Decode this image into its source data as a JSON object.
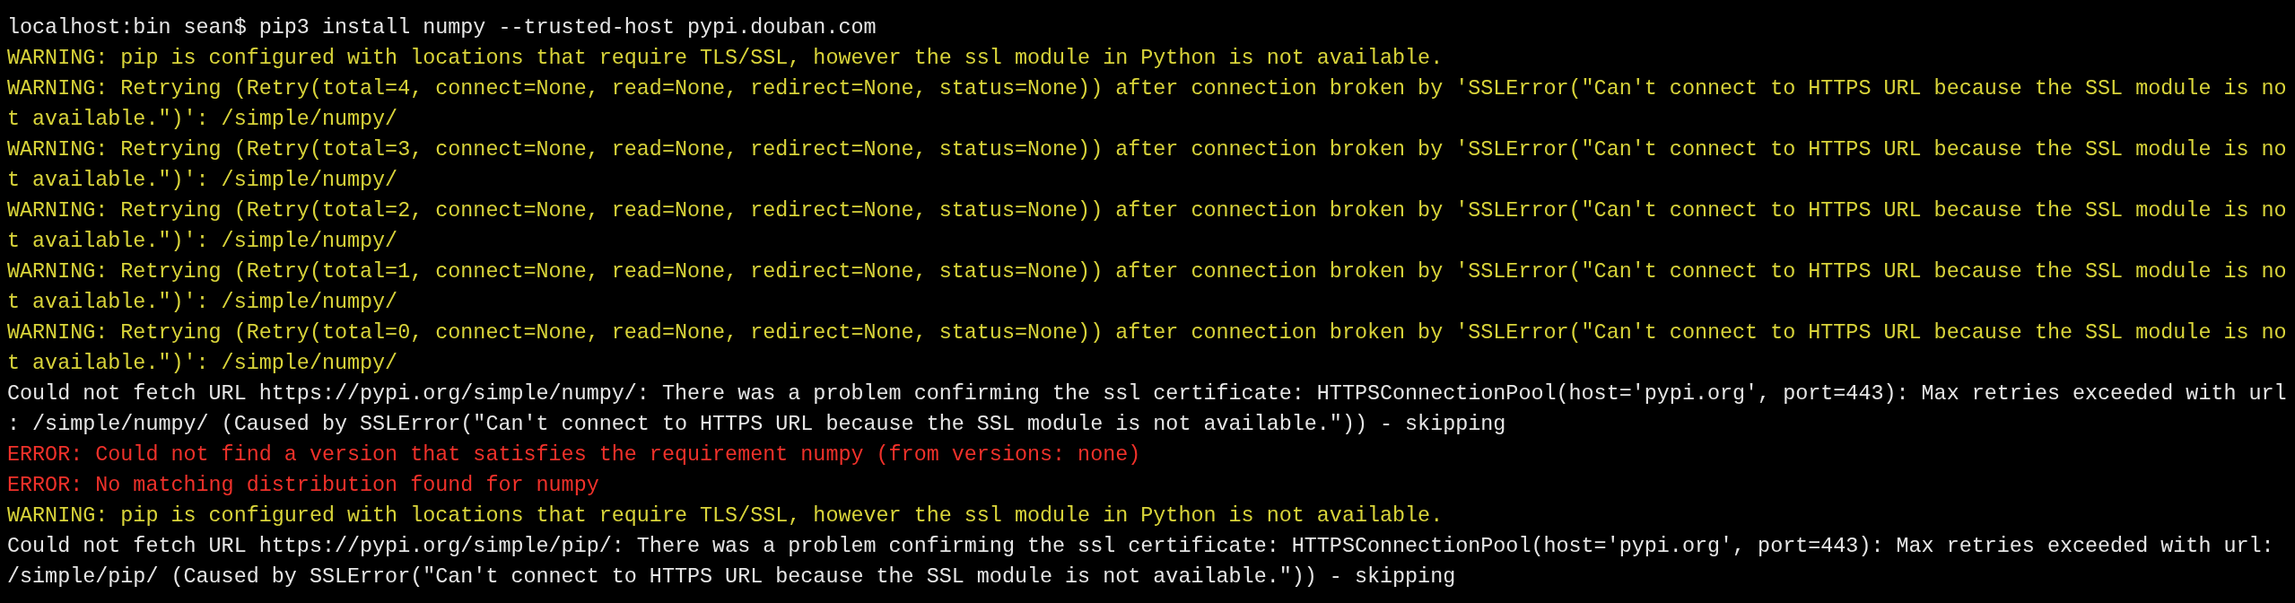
{
  "terminal": {
    "lines": [
      {
        "kind": "prompt",
        "text": "localhost:bin sean$ pip3 install numpy --trusted-host pypi.douban.com"
      },
      {
        "kind": "warning",
        "text": "WARNING: pip is configured with locations that require TLS/SSL, however the ssl module in Python is not available."
      },
      {
        "kind": "warning",
        "text": "WARNING: Retrying (Retry(total=4, connect=None, read=None, redirect=None, status=None)) after connection broken by 'SSLError(\"Can't connect to HTTPS URL because the SSL module is no"
      },
      {
        "kind": "warning",
        "text": "t available.\")': /simple/numpy/"
      },
      {
        "kind": "warning",
        "text": "WARNING: Retrying (Retry(total=3, connect=None, read=None, redirect=None, status=None)) after connection broken by 'SSLError(\"Can't connect to HTTPS URL because the SSL module is no"
      },
      {
        "kind": "warning",
        "text": "t available.\")': /simple/numpy/"
      },
      {
        "kind": "warning",
        "text": "WARNING: Retrying (Retry(total=2, connect=None, read=None, redirect=None, status=None)) after connection broken by 'SSLError(\"Can't connect to HTTPS URL because the SSL module is no"
      },
      {
        "kind": "warning",
        "text": "t available.\")': /simple/numpy/"
      },
      {
        "kind": "warning",
        "text": "WARNING: Retrying (Retry(total=1, connect=None, read=None, redirect=None, status=None)) after connection broken by 'SSLError(\"Can't connect to HTTPS URL because the SSL module is no"
      },
      {
        "kind": "warning",
        "text": "t available.\")': /simple/numpy/"
      },
      {
        "kind": "warning",
        "text": "WARNING: Retrying (Retry(total=0, connect=None, read=None, redirect=None, status=None)) after connection broken by 'SSLError(\"Can't connect to HTTPS URL because the SSL module is no"
      },
      {
        "kind": "warning",
        "text": "t available.\")': /simple/numpy/"
      },
      {
        "kind": "output",
        "text": "Could not fetch URL https://pypi.org/simple/numpy/: There was a problem confirming the ssl certificate: HTTPSConnectionPool(host='pypi.org', port=443): Max retries exceeded with url"
      },
      {
        "kind": "output",
        "text": ": /simple/numpy/ (Caused by SSLError(\"Can't connect to HTTPS URL because the SSL module is not available.\")) - skipping"
      },
      {
        "kind": "error",
        "text": "ERROR: Could not find a version that satisfies the requirement numpy (from versions: none)"
      },
      {
        "kind": "error",
        "text": "ERROR: No matching distribution found for numpy"
      },
      {
        "kind": "warning",
        "text": "WARNING: pip is configured with locations that require TLS/SSL, however the ssl module in Python is not available."
      },
      {
        "kind": "output",
        "text": "Could not fetch URL https://pypi.org/simple/pip/: There was a problem confirming the ssl certificate: HTTPSConnectionPool(host='pypi.org', port=443): Max retries exceeded with url:"
      },
      {
        "kind": "output",
        "text": "/simple/pip/ (Caused by SSLError(\"Can't connect to HTTPS URL because the SSL module is not available.\")) - skipping"
      }
    ]
  }
}
